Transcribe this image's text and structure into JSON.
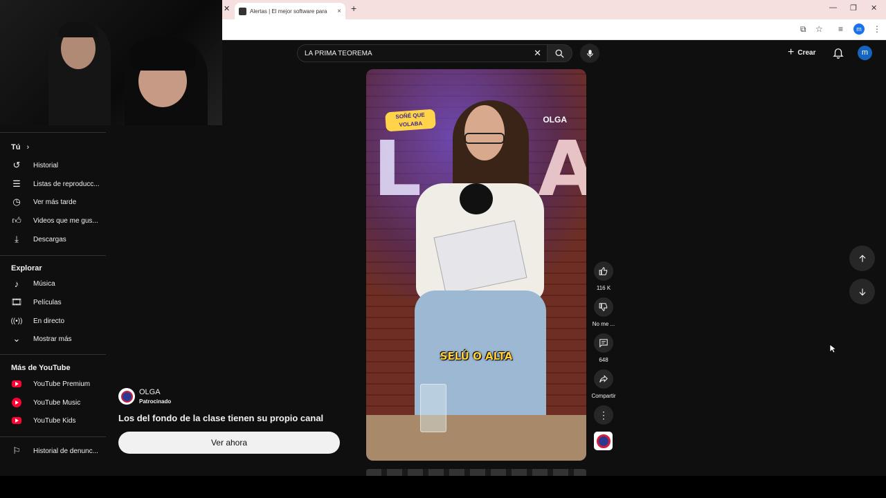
{
  "browser": {
    "tab_title": "Alertas | El mejor software para",
    "new_tab": "+",
    "tab_close": "×",
    "profile_initial": "m"
  },
  "header": {
    "search_value": "LA PRIMA TEOREMA",
    "create_label": "Crear",
    "avatar_initial": "m"
  },
  "sidebar": {
    "you_title": "Tú",
    "you_items": [
      {
        "label": "Historial",
        "icon": "history-icon"
      },
      {
        "label": "Listas de reproducc...",
        "icon": "playlists-icon"
      },
      {
        "label": "Ver más tarde",
        "icon": "watch-later-icon"
      },
      {
        "label": "Videos que me gus...",
        "icon": "liked-videos-icon"
      },
      {
        "label": "Descargas",
        "icon": "downloads-icon"
      }
    ],
    "explore_title": "Explorar",
    "explore_items": [
      {
        "label": "Música",
        "icon": "music-icon"
      },
      {
        "label": "Películas",
        "icon": "movies-icon"
      },
      {
        "label": "En directo",
        "icon": "live-icon"
      },
      {
        "label": "Mostrar más",
        "icon": "chevron-down-icon"
      }
    ],
    "more_title": "Más de YouTube",
    "more_items": [
      {
        "label": "YouTube Premium",
        "icon": "youtube-premium-icon"
      },
      {
        "label": "YouTube Music",
        "icon": "youtube-music-icon"
      },
      {
        "label": "YouTube Kids",
        "icon": "youtube-kids-icon"
      }
    ],
    "report_item": {
      "label": "Historial de denunc...",
      "icon": "flag-icon"
    }
  },
  "video": {
    "badge_text": "SOÑÉ QUE VOLABA",
    "channel_logo": "OLGA",
    "caption": "SELÚ O ALTA"
  },
  "actions": {
    "likes": "116 K",
    "dislike_label": "No me ...",
    "comments": "648",
    "share_label": "Compartir"
  },
  "ad": {
    "channel_name": "OLGA",
    "sponsored": "Patrocinado",
    "title": "Los del fondo de la clase tienen su propio canal",
    "cta": "Ver ahora"
  },
  "colors": {
    "background": "#0f0f0f",
    "accent_red": "#ff0033",
    "caption_yellow": "#ffcf33",
    "avatar_blue": "#1565c0"
  }
}
